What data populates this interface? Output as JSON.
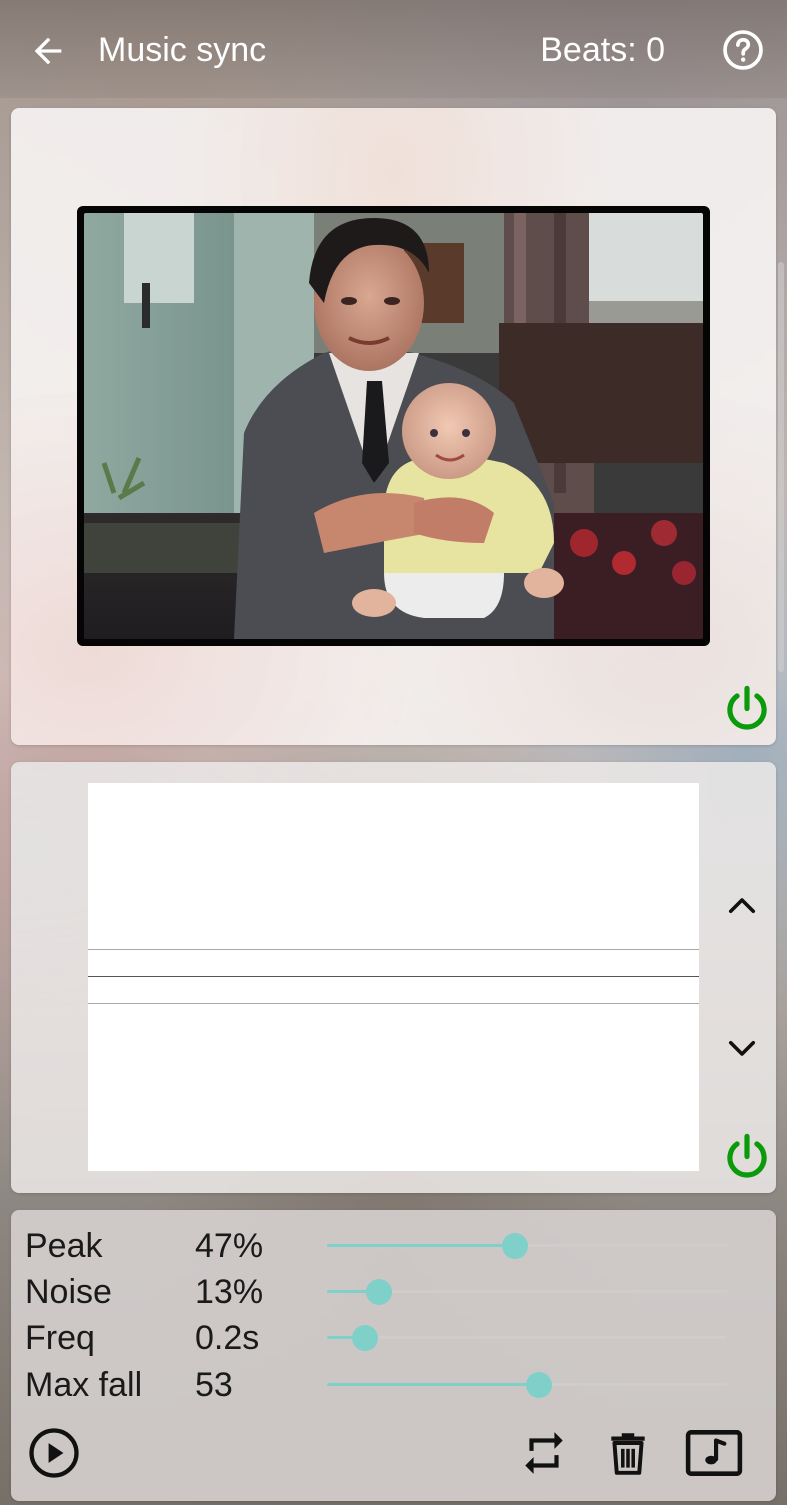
{
  "appbar": {
    "title": "Music sync",
    "beats_label": "Beats: 0",
    "back_icon": "arrow-left-icon",
    "help_icon": "help-circle-icon"
  },
  "photo_card": {
    "image_description_icon": "family-photo",
    "power_icon": "power-icon",
    "power_color": "#0a9a0a"
  },
  "waveform_card": {
    "up_icon": "chevron-up-icon",
    "down_icon": "chevron-down-icon",
    "power_icon": "power-icon",
    "power_color": "#0a9a0a"
  },
  "params": [
    {
      "label": "Peak",
      "value": "47%",
      "level": 0.47
    },
    {
      "label": "Noise",
      "value": "13%",
      "level": 0.13
    },
    {
      "label": "Freq",
      "value": "0.2s",
      "level": 0.095
    },
    {
      "label": "Max fall",
      "value": "53",
      "level": 0.53
    }
  ],
  "accent_color": "#7fd0c8",
  "bottom_bar": {
    "play_icon": "play-circle-icon",
    "repeat_icon": "repeat-icon",
    "delete_icon": "trash-icon",
    "music_icon": "music-note-icon"
  }
}
